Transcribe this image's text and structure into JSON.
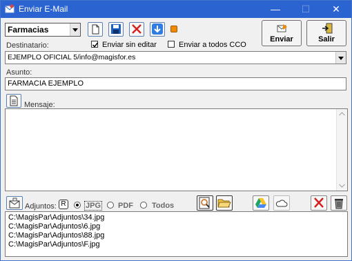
{
  "window": {
    "title": "Enviar E-Mail"
  },
  "toolbar": {
    "group_select_value": "Farmacias",
    "send_label": "Enviar",
    "exit_label": "Salir"
  },
  "recipient": {
    "label": "Destinatario:",
    "send_without_edit_label": "Enviar sin editar",
    "send_without_edit_checked": true,
    "send_all_cco_label": "Enviar a todos CCO",
    "send_all_cco_checked": false,
    "value": "EJEMPLO OFICIAL 5/info@magisfor.es"
  },
  "subject": {
    "label": "Asunto:",
    "value": "FARMACIA EJEMPLO"
  },
  "message": {
    "label": "Mensaje:",
    "value": ""
  },
  "attachments": {
    "label": "Adjuntos:",
    "r_label": "R",
    "formats": [
      {
        "label": "JPG",
        "selected": true
      },
      {
        "label": "PDF",
        "selected": false
      },
      {
        "label": "Todos",
        "selected": false
      }
    ],
    "files": [
      "C:\\MagisPar\\Adjuntos\\34.jpg",
      "C:\\MagisPar\\Adjuntos\\6.jpg",
      "C:\\MagisPar\\Adjuntos\\88.jpg",
      "C:\\MagisPar\\Adjuntos\\F.jpg"
    ]
  },
  "colors": {
    "titlebar": "#2b63d1",
    "save_blue": "#1f5fbf",
    "delete_red": "#d22020",
    "orange": "#f08a00"
  }
}
